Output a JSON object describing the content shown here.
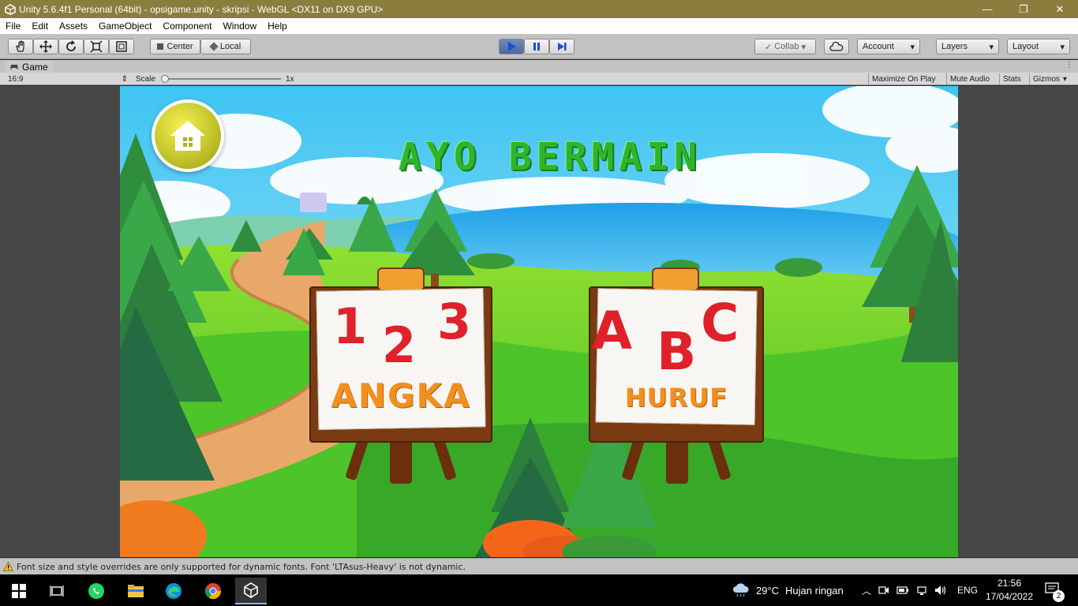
{
  "window": {
    "title": "Unity 5.6.4f1 Personal (64bit) - opsigame.unity - skripsi - WebGL <DX11 on DX9 GPU>",
    "minimize_glyph": "—",
    "maximize_glyph": "❐",
    "close_glyph": "✕"
  },
  "menu": [
    "File",
    "Edit",
    "Assets",
    "GameObject",
    "Component",
    "Window",
    "Help"
  ],
  "toolbar": {
    "center_label": "Center",
    "local_label": "Local",
    "collab_label": "Collab",
    "account_label": "Account",
    "layers_label": "Layers",
    "layout_label": "Layout",
    "dropdown_arrow": "▾"
  },
  "game_tab": {
    "label": "Game",
    "aspect": "16:9",
    "scale_label": "Scale",
    "scale_value": "1x",
    "scale_level": 0.0,
    "maximize_on_play": "Maximize On Play",
    "mute_audio": "Mute Audio",
    "stats": "Stats",
    "gizmos": "Gizmos"
  },
  "game": {
    "title": "AYO BERMAIN",
    "board_numbers": {
      "n1": "1",
      "n2": "2",
      "n3": "3",
      "label": "ANGKA"
    },
    "board_letters": {
      "a": "A",
      "b": "B",
      "c": "C",
      "label": "HURUF"
    },
    "colors": {
      "sky": "#44c8f0",
      "grass": "#5fd12e",
      "title_green": "#2fb52a",
      "red": "#e0202a",
      "orange": "#f0901e",
      "board_frame": "#7a3a12"
    }
  },
  "status_message": "Font size and style overrides are only supported for dynamic fonts. Font 'LTAsus-Heavy' is not dynamic.",
  "taskbar": {
    "icons": [
      "windows-icon",
      "task-view-icon",
      "whatsapp-icon",
      "file-explorer-icon",
      "edge-icon",
      "chrome-icon",
      "unity-icon"
    ],
    "weather_temp": "29°C",
    "weather_text": "Hujan ringan",
    "language": "ENG",
    "time": "21:56",
    "date": "17/04/2022",
    "notification_count": "2"
  }
}
